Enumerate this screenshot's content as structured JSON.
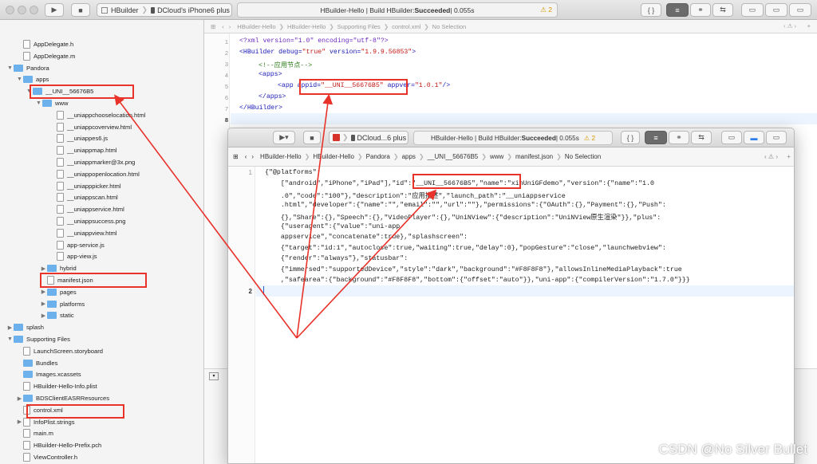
{
  "toolbar": {
    "scheme": "HBuilder",
    "device": "DCloud's iPhone6 plus",
    "status_prefix": "HBuilder-Hello | Build HBuilder: ",
    "status_bold": "Succeeded",
    "status_suffix": " | 0.055s",
    "warning_count": "2"
  },
  "sidebar": {
    "items": [
      {
        "label": "AppDelegate.h",
        "type": "file",
        "indent": 30
      },
      {
        "label": "AppDelegate.m",
        "type": "file",
        "indent": 30
      },
      {
        "label": "Pandora",
        "type": "folder",
        "indent": 18,
        "arrow": "▼"
      },
      {
        "label": "apps",
        "type": "folder",
        "indent": 30,
        "arrow": "▼"
      },
      {
        "label": "__UNI__56676B5",
        "type": "folder",
        "indent": 42,
        "arrow": "▼"
      },
      {
        "label": "www",
        "type": "folder",
        "indent": 54,
        "arrow": "▼"
      },
      {
        "label": "__uniappchooselocation.html",
        "type": "file",
        "indent": 72
      },
      {
        "label": "__uniappcoverview.html",
        "type": "file",
        "indent": 72
      },
      {
        "label": "__uniappes6.js",
        "type": "file",
        "indent": 72
      },
      {
        "label": "__uniappmap.html",
        "type": "file",
        "indent": 72
      },
      {
        "label": "__uniappmarker@3x.png",
        "type": "file",
        "indent": 72
      },
      {
        "label": "__uniappopenlocation.html",
        "type": "file",
        "indent": 72
      },
      {
        "label": "__uniapppicker.html",
        "type": "file",
        "indent": 72
      },
      {
        "label": "__uniappscan.html",
        "type": "file",
        "indent": 72
      },
      {
        "label": "__uniappservice.html",
        "type": "file",
        "indent": 72
      },
      {
        "label": "__uniappsuccess.png",
        "type": "file",
        "indent": 72
      },
      {
        "label": "__uniappview.html",
        "type": "file",
        "indent": 72
      },
      {
        "label": "app-service.js",
        "type": "file",
        "indent": 72
      },
      {
        "label": "app-view.js",
        "type": "file",
        "indent": 72
      },
      {
        "label": "hybrid",
        "type": "folder",
        "indent": 60,
        "arrow": "▶"
      },
      {
        "label": "manifest.json",
        "type": "file",
        "indent": 60
      },
      {
        "label": "pages",
        "type": "folder",
        "indent": 60,
        "arrow": "▶"
      },
      {
        "label": "platforms",
        "type": "folder",
        "indent": 60,
        "arrow": "▶"
      },
      {
        "label": "static",
        "type": "folder",
        "indent": 60,
        "arrow": "▶"
      },
      {
        "label": "splash",
        "type": "folder",
        "indent": 18,
        "arrow": "▶"
      },
      {
        "label": "Supporting Files",
        "type": "folder",
        "indent": 18,
        "arrow": "▼"
      },
      {
        "label": "LaunchScreen.storyboard",
        "type": "file",
        "indent": 30
      },
      {
        "label": "Bundles",
        "type": "folder",
        "indent": 30
      },
      {
        "label": "Images.xcassets",
        "type": "folder",
        "indent": 30
      },
      {
        "label": "HBuilder-Hello-Info.plist",
        "type": "file",
        "indent": 30
      },
      {
        "label": "BDSClientEASRResources",
        "type": "folder",
        "indent": 30,
        "arrow": "▶"
      },
      {
        "label": "control.xml",
        "type": "file",
        "indent": 30
      },
      {
        "label": "InfoPlist.strings",
        "type": "file",
        "indent": 30,
        "arrow": "▶"
      },
      {
        "label": "main.m",
        "type": "file",
        "indent": 30
      },
      {
        "label": "HBuilder-Hello-Prefix.pch",
        "type": "file",
        "indent": 30
      },
      {
        "label": "ViewController.h",
        "type": "file",
        "indent": 30
      }
    ]
  },
  "jumpbar": {
    "crumbs": [
      "HBuilder-Hello",
      "HBuilder-Hello",
      "Supporting Files",
      "control.xml",
      "No Selection"
    ]
  },
  "xml": {
    "line1": "<?xml version=\"1.0\" encoding=\"utf-8\"?>",
    "line2_a": "<HBuilder debug=",
    "line2_b": "\"true\"",
    "line2_c": " version=",
    "line2_d": "\"1.9.9.56853\"",
    "line2_e": ">",
    "line3": "<!--应用节点-->",
    "line4": "<apps>",
    "line5_a": "<app ",
    "line5_b": "appid=",
    "line5_c": "\"__UNI__56676B5\"",
    "line5_d": " appver=",
    "line5_e": "\"1.0.1\"",
    "line5_f": "/>",
    "line6": "</apps>",
    "line7": "</HBuilder>"
  },
  "overlay": {
    "device": "DCloud...6 plus",
    "status_prefix": "HBuilder-Hello | Build HBuilder: ",
    "status_bold": "Succeeded",
    "status_suffix": " | 0.055s",
    "warning_count": "2",
    "crumbs": [
      "HBuilder-Hello",
      "HBuilder-Hello",
      "Pandora",
      "apps",
      "__UNI__56676B5",
      "www",
      "manifest.json",
      "No Selection"
    ],
    "json": [
      "{\"@platforms\":",
      "    [\"android\",\"iPhone\",\"iPad\"],\"id\":\"__UNI__56676B5\",\"name\":\"xinUniGFdemo\",\"version\":{\"name\":\"1.0",
      "    .0\",\"code\":\"100\"},\"description\":\"应用描述\",\"launch_path\":\"__uniappservice",
      "    .html\",\"developer\":{\"name\":\"\",\"email\":\"\",\"url\":\"\"},\"permissions\":{\"OAuth\":{},\"Payment\":{},\"Push\":",
      "    {},\"Share\":{},\"Speech\":{},\"VideoPlayer\":{},\"UniNView\":{\"description\":\"UniNView原生渲染\"}},\"plus\":",
      "    {\"useragent\":{\"value\":\"uni-app",
      "    appservice\",\"concatenate\":true},\"splashscreen\":",
      "    {\"target\":\"id:1\",\"autoclose\":true,\"waiting\":true,\"delay\":0},\"popGesture\":\"close\",\"launchwebview\":",
      "    {\"render\":\"always\"},\"statusbar\":",
      "    {\"immersed\":\"supportedDevice\",\"style\":\"dark\",\"background\":\"#F8F8F8\"},\"allowsInlineMediaPlayback\":true",
      "    ,\"safearea\":{\"background\":\"#F8F8F8\",\"bottom\":{\"offset\":\"auto\"}},\"uni-app\":{\"compilerVersion\":\"1.7.0\"}}}"
    ]
  },
  "watermark": "CSDN @No Silver Bullet",
  "colors": {
    "highlight": "#e8322a",
    "folder": "#6cb0ec"
  }
}
